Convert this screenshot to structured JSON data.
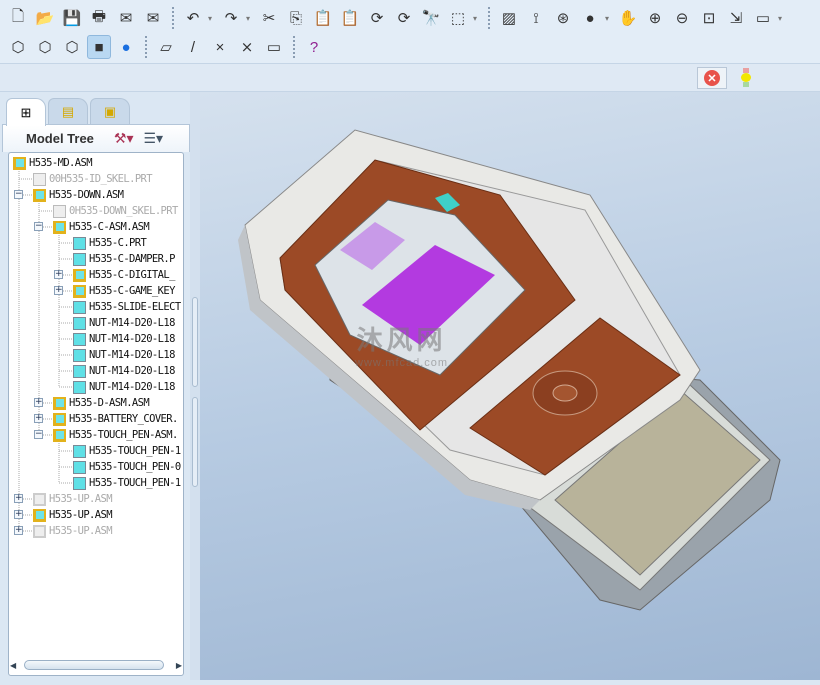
{
  "toolbar": {
    "row1": [
      "new-icon",
      "open-icon",
      "save-icon",
      "print-icon",
      "email-attach-icon",
      "email-link-icon",
      "|",
      "undo-icon",
      "redo-icon",
      "cut-icon",
      "copy-icon",
      "paste-icon",
      "paste-special-icon",
      "regenerate-icon",
      "regenerate-manager-icon",
      "find-icon",
      "select-box-icon",
      "|",
      "repaint-icon",
      "spin-center-icon",
      "orient-mode-icon",
      "shading-icon",
      "pan-icon",
      "zoom-in-icon",
      "zoom-out-icon",
      "refit-icon",
      "reorient-icon",
      "saved-views-icon"
    ],
    "row2": [
      "wireframe-icon",
      "hidden-line-icon",
      "no-hidden-icon",
      "shading-mode-icon",
      "enhanced-realism-icon",
      "|",
      "datum-planes-display-icon",
      "datum-axes-display-icon",
      "point-display-icon",
      "csys-display-icon",
      "annotation-display-icon",
      "|",
      "context-help-icon"
    ]
  },
  "status": {
    "stop": "stop-icon",
    "light": "traffic-light-icon"
  },
  "panel": {
    "tabs": [
      "model-tree-tab-icon",
      "layer-tab-icon",
      "favorites-tab-icon"
    ],
    "title": "Model Tree",
    "settings_icon": "tree-settings-icon",
    "columns_icon": "tree-columns-icon",
    "items": [
      {
        "label": "H535-MD.ASM",
        "level": 0,
        "type": "asm",
        "exp": ""
      },
      {
        "label": "00H535-ID_SKEL.PRT",
        "level": 1,
        "type": "skel",
        "exp": ""
      },
      {
        "label": "H535-DOWN.ASM",
        "level": 1,
        "type": "asm",
        "exp": "-"
      },
      {
        "label": "0H535-DOWN_SKEL.PRT",
        "level": 2,
        "type": "skel",
        "exp": ""
      },
      {
        "label": "H535-C-ASM.ASM",
        "level": 2,
        "type": "asm",
        "exp": "-"
      },
      {
        "label": "H535-C.PRT",
        "level": 3,
        "type": "prt",
        "exp": ""
      },
      {
        "label": "H535-C-DAMPER.P",
        "level": 3,
        "type": "prt",
        "exp": ""
      },
      {
        "label": "H535-C-DIGITAL_",
        "level": 3,
        "type": "asm",
        "exp": "+"
      },
      {
        "label": "H535-C-GAME_KEY",
        "level": 3,
        "type": "asm",
        "exp": "+"
      },
      {
        "label": "H535-SLIDE-ELECT",
        "level": 3,
        "type": "prt",
        "exp": ""
      },
      {
        "label": "NUT-M14-D20-L18",
        "level": 3,
        "type": "prt",
        "exp": ""
      },
      {
        "label": "NUT-M14-D20-L18",
        "level": 3,
        "type": "prt",
        "exp": ""
      },
      {
        "label": "NUT-M14-D20-L18",
        "level": 3,
        "type": "prt",
        "exp": ""
      },
      {
        "label": "NUT-M14-D20-L18",
        "level": 3,
        "type": "prt",
        "exp": ""
      },
      {
        "label": "NUT-M14-D20-L18",
        "level": 3,
        "type": "prt",
        "exp": ""
      },
      {
        "label": "H535-D-ASM.ASM",
        "level": 2,
        "type": "asm",
        "exp": "+"
      },
      {
        "label": "H535-BATTERY_COVER.",
        "level": 2,
        "type": "asm",
        "exp": "+"
      },
      {
        "label": "H535-TOUCH_PEN-ASM.",
        "level": 2,
        "type": "asm",
        "exp": "-"
      },
      {
        "label": "H535-TOUCH_PEN-1",
        "level": 3,
        "type": "prt",
        "exp": ""
      },
      {
        "label": "H535-TOUCH_PEN-0",
        "level": 3,
        "type": "prt",
        "exp": ""
      },
      {
        "label": "H535-TOUCH_PEN-1",
        "level": 3,
        "type": "prt",
        "exp": ""
      },
      {
        "label": "H535-UP.ASM",
        "level": 1,
        "type": "gasm",
        "exp": "+"
      },
      {
        "label": "H535-UP.ASM",
        "level": 1,
        "type": "asm",
        "exp": "+"
      },
      {
        "label": "H535-UP.ASM",
        "level": 1,
        "type": "gasm",
        "exp": "+"
      }
    ]
  },
  "viewport": {
    "watermark": "沐风网",
    "watermark_url": "www.mfcad.com"
  }
}
